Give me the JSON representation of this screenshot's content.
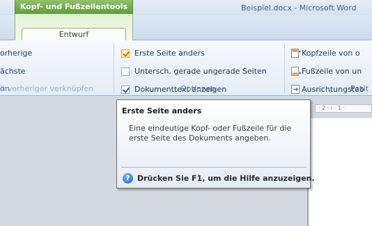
{
  "window": {
    "title": "Beispiel.docx - Microsoft Word"
  },
  "context_tab": {
    "header": "Kopf- und Fußzeilentools",
    "tab": "Entwurf"
  },
  "navigation_group": {
    "items": [
      "orherige",
      "ächste",
      "it vorheriger verknüpfen"
    ],
    "label": "on"
  },
  "options_group": {
    "checkboxes": [
      {
        "label": "Erste Seite anders",
        "checked": true
      },
      {
        "label": "Untersch. gerade  ungerade Seiten",
        "checked": false
      },
      {
        "label": "Dokumenttext anzeigen",
        "checked": true
      }
    ],
    "label": "Optionen"
  },
  "position_group": {
    "items": [
      {
        "label": "Kopfzeile von o",
        "icon": "header-position-icon"
      },
      {
        "label": "Fußzeile von un",
        "icon": "footer-position-icon"
      },
      {
        "label": "Ausrichtungstab",
        "icon": "alignment-tab-icon"
      }
    ],
    "label": "Posit"
  },
  "ruler": {
    "text": "· 2 · ı · 1 ·"
  },
  "tooltip": {
    "title": "Erste Seite anders",
    "body": "Eine eindeutige Kopf- oder Fußzeile für die erste Seite des Dokuments angeben.",
    "help": "Drücken Sie F1, um die Hilfe anzuzeigen."
  },
  "colors": {
    "context_green": "#5e9c3b",
    "check_orange": "#d76b00",
    "ribbon_text": "#1e395b"
  }
}
